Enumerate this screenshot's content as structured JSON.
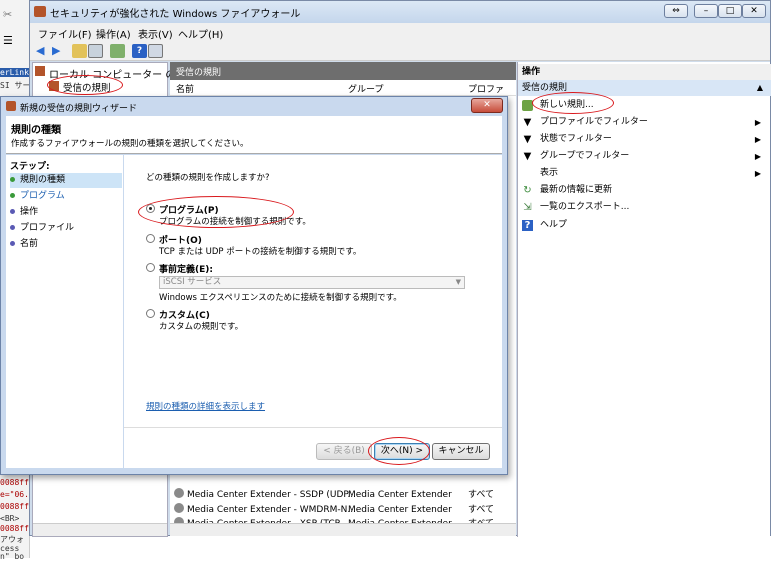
{
  "window": {
    "title": "セキュリティが強化された Windows ファイアウォール"
  },
  "menu": [
    "ファイル(F)",
    "操作(A)",
    "表示(V)",
    "ヘルプ(H)"
  ],
  "tree": {
    "root": "ローカル コンピューター のセ",
    "selected": "受信の規則"
  },
  "center": {
    "header": "受信の規則",
    "columns": [
      "名前",
      "グループ",
      "プロファ"
    ],
    "rows": [
      {
        "name": "Media Center Extender - SSDP (UDP...",
        "group": "Media Center Extender",
        "profile": "すべて"
      },
      {
        "name": "Media Center Extender - WMDRM-N...",
        "group": "Media Center Extender",
        "profile": "すべて"
      },
      {
        "name": "Media Center Extender - XSP (TCP...",
        "group": "Media Center Extender",
        "profile": "すべて"
      }
    ]
  },
  "actions": {
    "header": "操作",
    "section": "受信の規則",
    "items": [
      {
        "label": "新しい規則...",
        "icon": "new-rule-icon",
        "arrow": ""
      },
      {
        "label": "プロファイルでフィルター",
        "icon": "filter-icon",
        "arrow": "▶"
      },
      {
        "label": "状態でフィルター",
        "icon": "filter-icon",
        "arrow": "▶"
      },
      {
        "label": "グループでフィルター",
        "icon": "filter-icon",
        "arrow": "▶"
      },
      {
        "label": "表示",
        "icon": "",
        "arrow": "▶"
      },
      {
        "label": "最新の情報に更新",
        "icon": "refresh-icon",
        "arrow": ""
      },
      {
        "label": "一覧のエクスポート...",
        "icon": "export-icon",
        "arrow": ""
      },
      {
        "label": "ヘルプ",
        "icon": "help-icon",
        "arrow": ""
      }
    ]
  },
  "dialog": {
    "title": "新規の受信の規則ウィザード",
    "heading": "規則の種類",
    "subheading": "作成するファイアウォールの規則の種類を選択してください。",
    "steps_label": "ステップ:",
    "steps": [
      "規則の種類",
      "プログラム",
      "操作",
      "プロファイル",
      "名前"
    ],
    "question": "どの種類の規則を作成しますか?",
    "options": [
      {
        "title": "プログラム(P)",
        "desc": "プログラムの接続を制御する規則です。",
        "selected": true
      },
      {
        "title": "ポート(O)",
        "desc": "TCP または UDP ポートの接続を制御する規則です。",
        "selected": false
      },
      {
        "title": "事前定義(E):",
        "desc": "Windows エクスペリエンスのために接続を制御する規則です。",
        "selected": false,
        "combo": "iSCSI サービス"
      },
      {
        "title": "カスタム(C)",
        "desc": "カスタムの規則です。",
        "selected": false
      }
    ],
    "link": "規則の種類の詳細を表示します",
    "buttons": {
      "back": "< 戻る(B)",
      "next": "次へ(N) >",
      "cancel": "キャンセル"
    }
  },
  "bg_code": [
    "erLink P",
    "SI サービ",
    "",
    "",
    "",
    "",
    "",
    "",
    "",
    "",
    "",
    "",
    "",
    "",
    "",
    "",
    "",
    "",
    "",
    "",
    "",
    "",
    "0088ff",
    "e=\"06.1",
    "0088ff",
    "<BR>",
    "0088ff",
    "アウォ",
    "cess",
    "n\" bo"
  ],
  "colors": {
    "accent": "#d9181c",
    "link": "#1c5fb0",
    "selection": "#cde4f7"
  }
}
